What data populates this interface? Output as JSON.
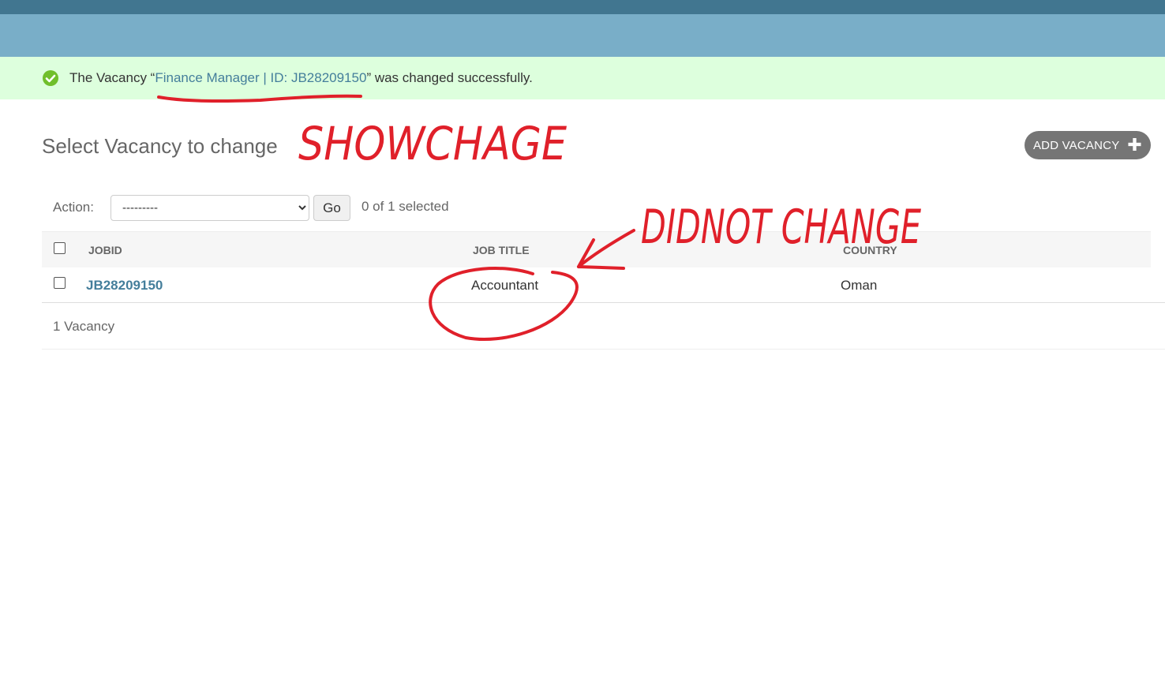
{
  "message": {
    "prefix": "The Vacancy “",
    "link": "Finance Manager | ID: JB28209150",
    "suffix": "” was changed successfully."
  },
  "page_title": "Select Vacancy to change",
  "add_button": {
    "label": "ADD VACANCY",
    "icon": "plus-icon"
  },
  "actions": {
    "label": "Action:",
    "select_value": "---------",
    "go_label": "Go",
    "selected_count": "0 of 1 selected"
  },
  "table": {
    "headers": {
      "jobid": "JOBID",
      "job_title": "JOB TITLE",
      "country": "COUNTRY"
    },
    "rows": [
      {
        "jobid": "JB28209150",
        "job_title": "Accountant",
        "country": "Oman"
      }
    ]
  },
  "paginator": "1 Vacancy",
  "annotations": {
    "show_change": "SHOWCHAGE",
    "did_not_change": "DIDNOT CHANGE",
    "color": "#e0202a"
  },
  "colors": {
    "header_dark": "#417690",
    "header_light": "#79aec8",
    "success_bg": "#dddddd",
    "link": "#447e9b"
  }
}
